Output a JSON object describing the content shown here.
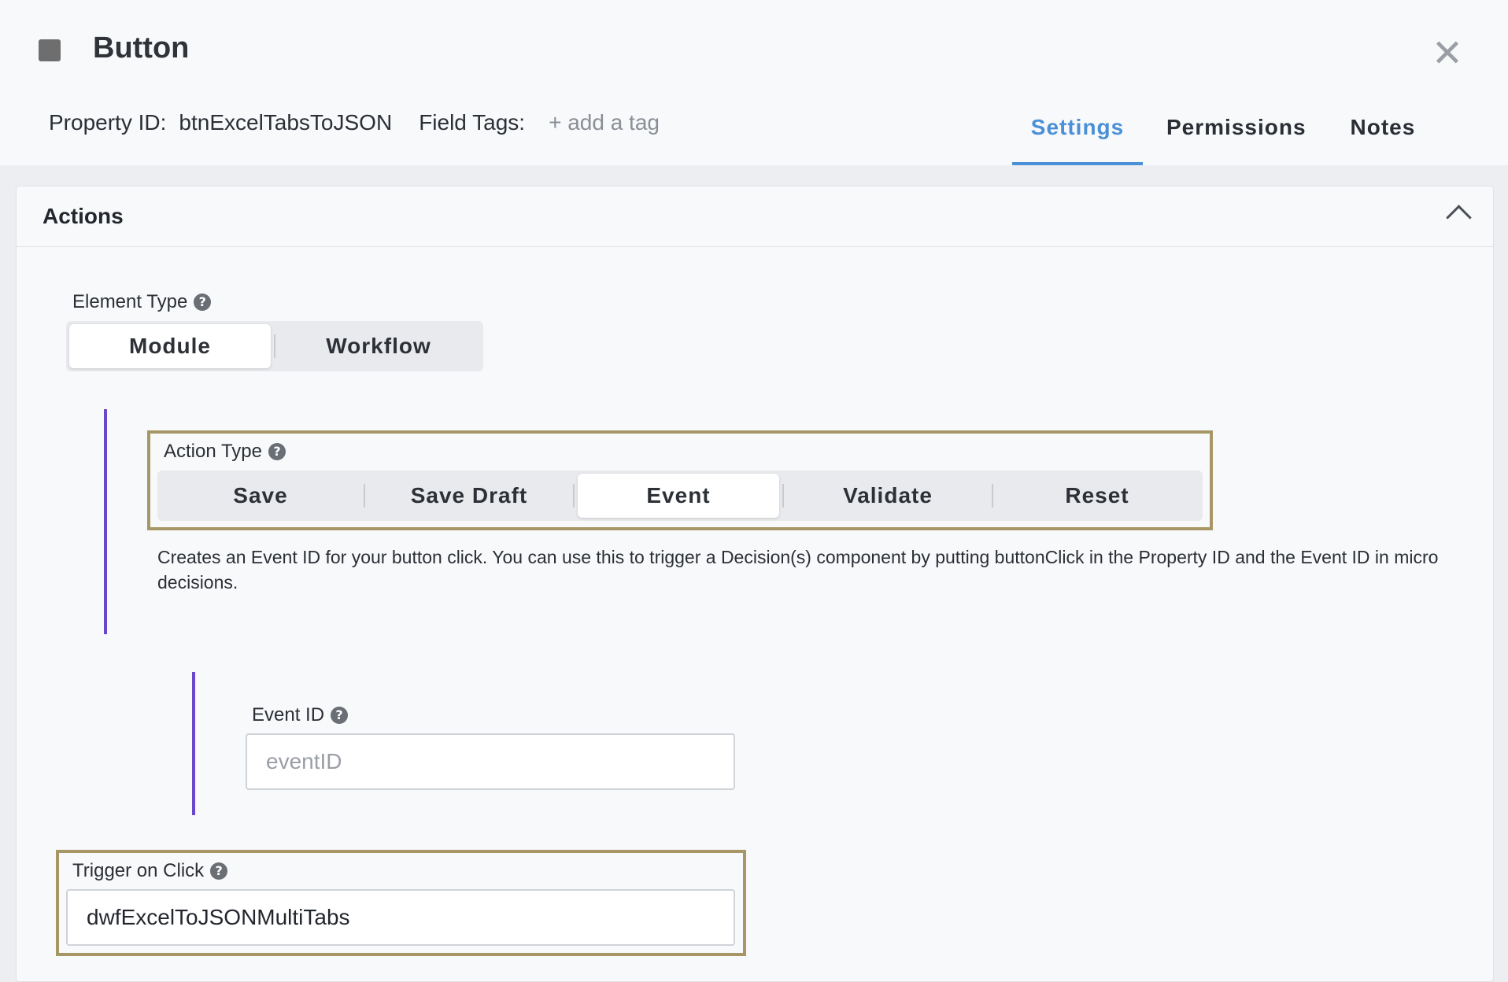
{
  "header": {
    "title": "Button",
    "close_glyph": "✕",
    "property_id_label": "Property ID:",
    "property_id_value": "btnExcelTabsToJSON",
    "field_tags_label": "Field Tags:",
    "add_tag_label": "+ add a tag"
  },
  "tabs": [
    {
      "label": "Settings",
      "active": true
    },
    {
      "label": "Permissions",
      "active": false
    },
    {
      "label": "Notes",
      "active": false
    }
  ],
  "actions_panel": {
    "title": "Actions",
    "element_type": {
      "label": "Element Type",
      "options": [
        "Module",
        "Workflow"
      ],
      "selected": "Module"
    },
    "action_type": {
      "label": "Action Type",
      "options": [
        "Save",
        "Save Draft",
        "Event",
        "Validate",
        "Reset"
      ],
      "selected": "Event",
      "description": "Creates an Event ID for your button click. You can use this to trigger a Decision(s) component by putting buttonClick in the Property ID and the Event ID in micro decisions."
    },
    "event_id": {
      "label": "Event ID",
      "placeholder": "eventID",
      "value": ""
    },
    "trigger_on_click": {
      "label": "Trigger on Click",
      "value": "dwfExcelToJSONMultiTabs"
    }
  },
  "colors": {
    "accent": "#4a8fd7",
    "indent_bar": "#6a48c9",
    "highlight_border": "#a89766"
  },
  "icons": {
    "help": "?"
  }
}
